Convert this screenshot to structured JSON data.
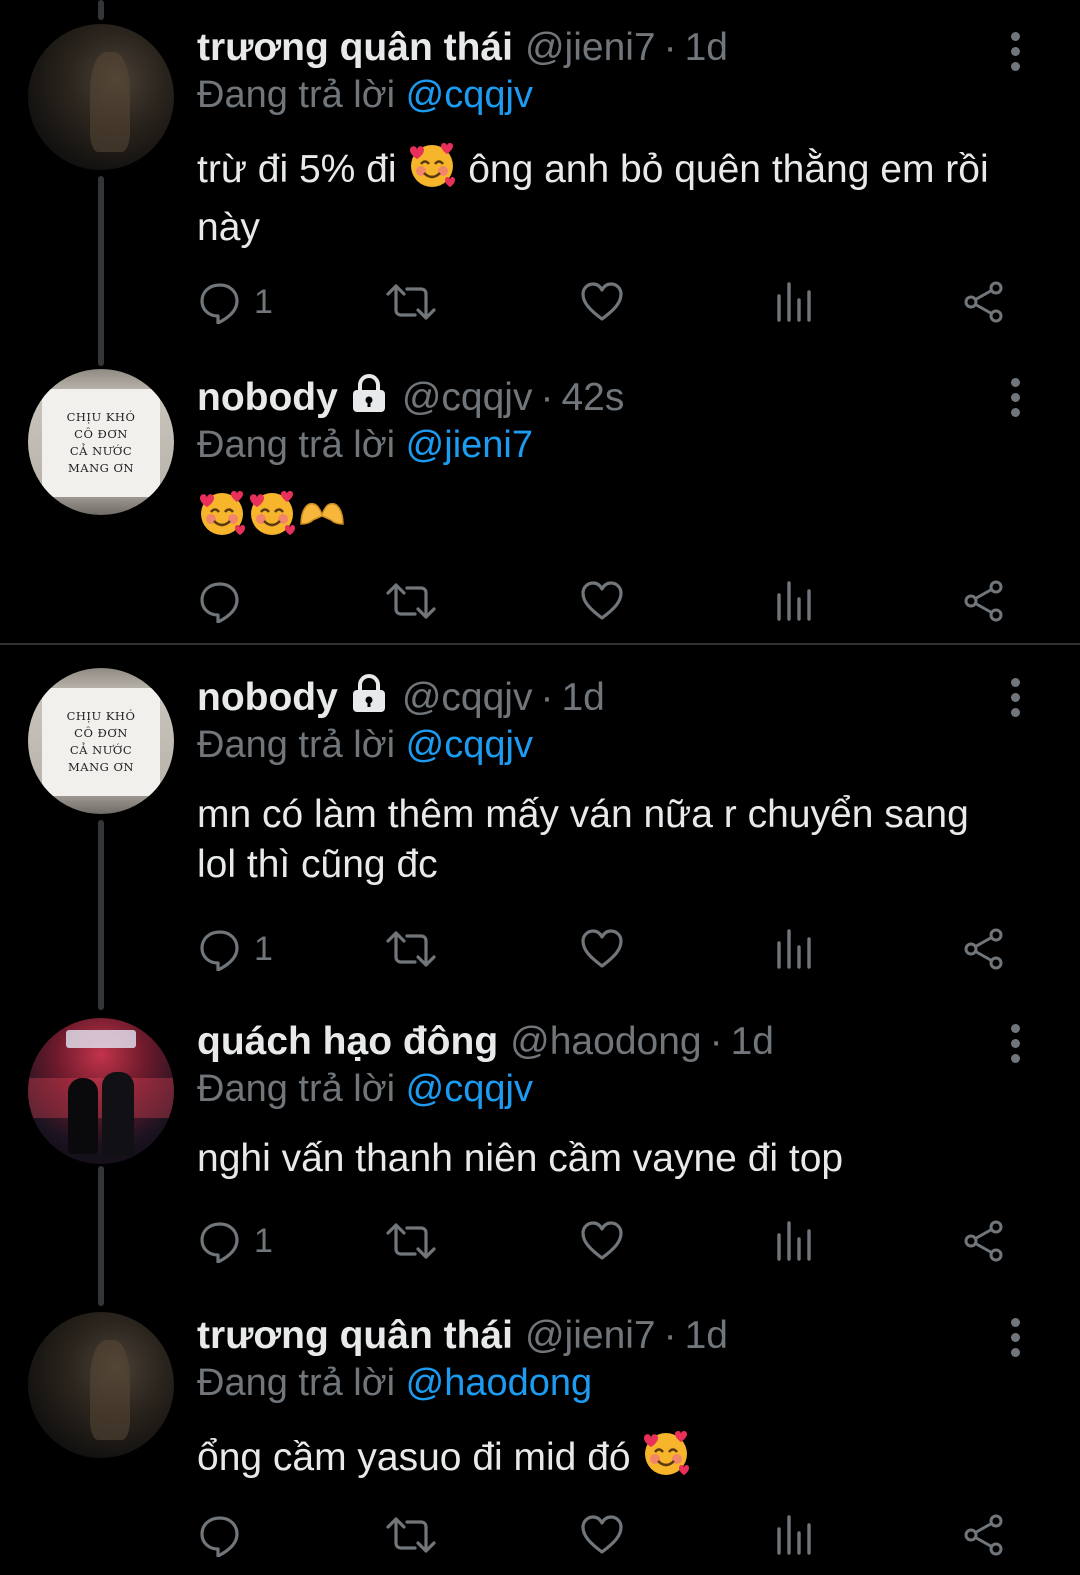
{
  "reply_prefix": "Đang trả lời",
  "tweets": [
    {
      "name": "trương quân thái",
      "handle": "@jieni7",
      "separator": "·",
      "time": "1d",
      "reply_to": "@cqqjv",
      "text_before": "trừ đi 5% đi",
      "text_after": "ông anh bỏ quên thằng em rồi này",
      "reply_count": "1",
      "avatar": "dark-figure-photo"
    },
    {
      "name": "nobody",
      "handle": "@cqqjv",
      "separator": "·",
      "time": "42s",
      "reply_to": "@jieni7",
      "emojis": [
        "smiling-face-with-hearts",
        "smiling-face-with-hearts",
        "heart-hands"
      ],
      "reply_count": "",
      "avatar": "sign-photo",
      "avatar_sign_lines": [
        "CHỊU KHÓ",
        "CÔ ĐƠN",
        "CẢ NƯỚC",
        "MANG ƠN"
      ]
    },
    {
      "name": "nobody",
      "handle": "@cqqjv",
      "separator": "·",
      "time": "1d",
      "reply_to": "@cqqjv",
      "text": "mn có làm thêm mấy ván nữa r chuyển sang lol thì cũng đc",
      "reply_count": "1",
      "avatar": "sign-photo",
      "avatar_sign_lines": [
        "CHỊU KHÓ",
        "CÔ ĐƠN",
        "CẢ NƯỚC",
        "MANG ƠN"
      ]
    },
    {
      "name": "quách hạo đông",
      "handle": "@haodong",
      "separator": "·",
      "time": "1d",
      "reply_to": "@cqqjv",
      "text": "nghi vấn thanh niên cầm vayne đi top",
      "reply_count": "1",
      "avatar": "night-street-photo"
    },
    {
      "name": "trương quân thái",
      "handle": "@jieni7",
      "separator": "·",
      "time": "1d",
      "reply_to": "@haodong",
      "text_before": "ổng cầm yasuo đi mid đó",
      "reply_count": "",
      "avatar": "dark-figure-photo"
    }
  ],
  "colors": {
    "background": "#000000",
    "text": "#e7e9ea",
    "muted": "#71767b",
    "mention": "#1d9bf0",
    "thread_line": "#333639"
  }
}
